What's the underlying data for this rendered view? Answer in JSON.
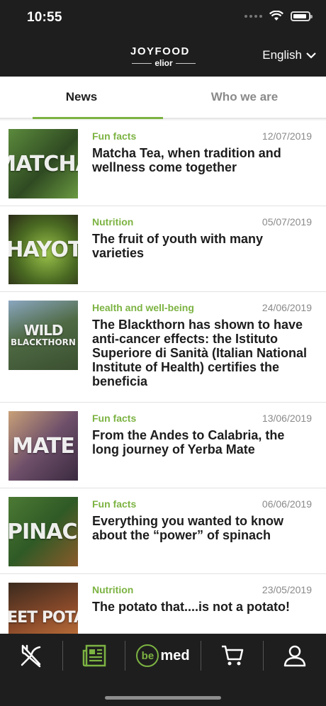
{
  "status": {
    "time": "10:55"
  },
  "header": {
    "logo_main": "JOYFOOD",
    "logo_sub": "elior",
    "language": "English"
  },
  "tabs": [
    {
      "label": "News",
      "active": true
    },
    {
      "label": "Who we are",
      "active": false
    }
  ],
  "news": [
    {
      "category": "Fun facts",
      "date": "12/07/2019",
      "title": "Matcha Tea, when tradition and wellness come together",
      "thumb_text": "MATCHA",
      "thumb_color": "#3e6b2f"
    },
    {
      "category": "Nutrition",
      "date": "05/07/2019",
      "title": "The fruit of youth with many varieties",
      "thumb_text": "CHAYOTE",
      "thumb_color": "#5a7a2a"
    },
    {
      "category": "Health and well-being",
      "date": "24/06/2019",
      "title": "The Blackthorn has shown to have anti-cancer effects: the Istituto Superiore di Sanità (Italian National Institute of Health) certifies the beneficia",
      "thumb_text": "WILD",
      "thumb_text2": "BLACKTHORN",
      "thumb_color": "#4f6a44"
    },
    {
      "category": "Fun facts",
      "date": "13/06/2019",
      "title": "From the Andes to Calabria, the long journey of Yerba Mate",
      "thumb_text": "MATE",
      "thumb_color": "#6e4f6a"
    },
    {
      "category": "Fun facts",
      "date": "06/06/2019",
      "title": "Everything you wanted to know about the “power” of spinach",
      "thumb_text": "SPINACH",
      "thumb_color": "#2f5a26"
    },
    {
      "category": "Nutrition",
      "date": "23/05/2019",
      "title": "The potato that....is not a potato!",
      "thumb_text": "SWEET POTATO",
      "thumb_color": "#8a4a2a"
    }
  ],
  "bottom_nav": {
    "bemed_badge": "be",
    "bemed_text": "med",
    "accent": "#7cb342"
  }
}
